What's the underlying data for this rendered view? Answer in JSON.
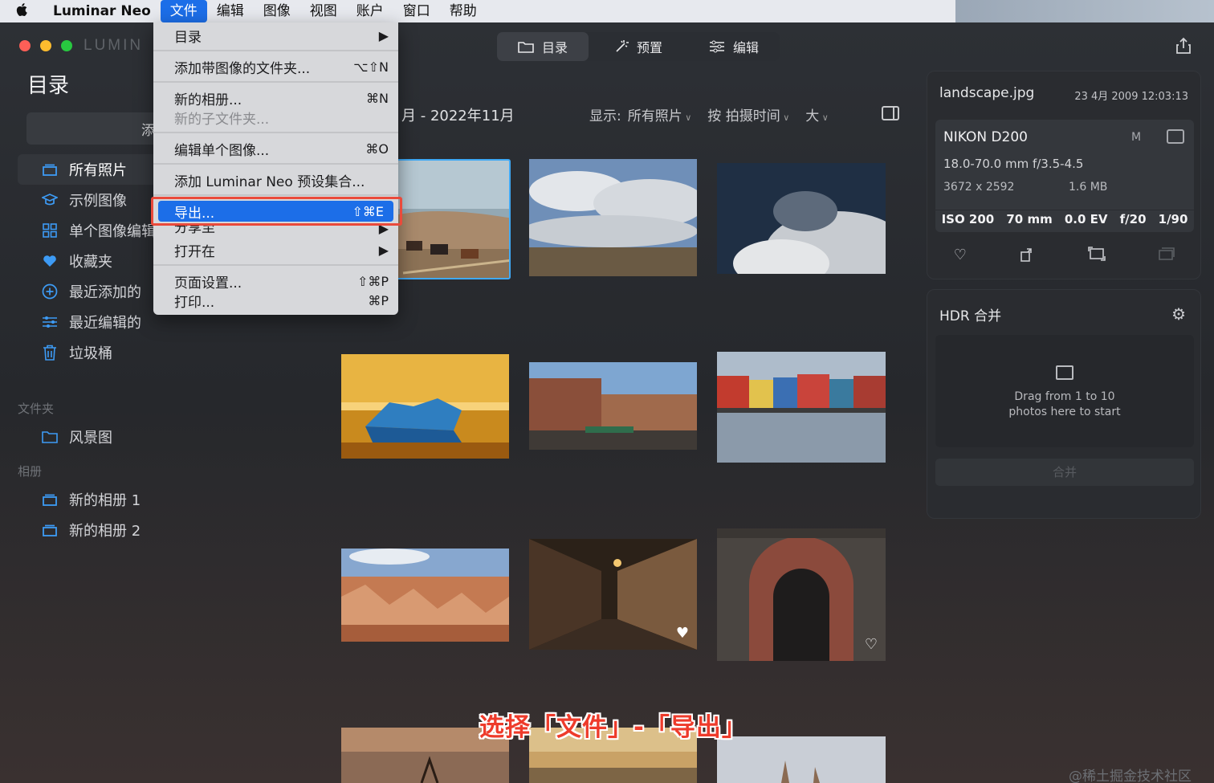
{
  "menubar": {
    "apple": "",
    "items": [
      "Luminar Neo",
      "文件",
      "编辑",
      "图像",
      "视图",
      "账户",
      "窗口",
      "帮助"
    ]
  },
  "window": {
    "brand": "LUMIN",
    "top_tabs": [
      {
        "label": "目录",
        "icon": "catalog-icon"
      },
      {
        "label": "预置",
        "icon": "presets-icon"
      },
      {
        "label": "编辑",
        "icon": "edit-sliders-icon"
      }
    ]
  },
  "sidebar": {
    "title": "目录",
    "add_label": "添",
    "items": [
      {
        "label": "所有照片",
        "icon": "stack-icon"
      },
      {
        "label": "示例图像",
        "icon": "graduation-cap-icon"
      },
      {
        "label": "单个图像编辑",
        "icon": "grid-icon"
      },
      {
        "label": "收藏夹",
        "icon": "heart-icon"
      },
      {
        "label": "最近添加的",
        "icon": "plus-circle-icon"
      },
      {
        "label": "最近编辑的",
        "icon": "sliders-icon"
      },
      {
        "label": "垃圾桶",
        "icon": "trash-icon"
      }
    ],
    "folders_label": "文件夹",
    "folders": [
      {
        "label": "风景图",
        "icon": "folder-icon"
      }
    ],
    "albums_label": "相册",
    "albums": [
      {
        "label": "新的相册 1",
        "icon": "album-icon"
      },
      {
        "label": "新的相册 2",
        "icon": "album-icon"
      }
    ]
  },
  "main": {
    "date_heading": "月 - 2022年11月",
    "filter_show_label": "显示:",
    "filter_show_value": "所有照片",
    "filter_sort": "按 拍摄时间",
    "filter_size": "大"
  },
  "file_menu": {
    "items": [
      {
        "label": "目录",
        "shortcut": "▶"
      },
      {
        "label": "添加带图像的文件夹...",
        "shortcut": "⌥⇧N"
      },
      {
        "label": "新的相册...",
        "shortcut": "⌘N"
      },
      {
        "label": "新的子文件夹...",
        "shortcut": ""
      },
      {
        "label": "编辑单个图像...",
        "shortcut": "⌘O"
      },
      {
        "label": "添加 Luminar Neo 预设集合...",
        "shortcut": ""
      },
      {
        "label": "导出...",
        "shortcut": "⇧⌘E"
      },
      {
        "label": "分享至",
        "shortcut": "▶"
      },
      {
        "label": "打开在",
        "shortcut": "▶"
      },
      {
        "label": "页面设置...",
        "shortcut": "⇧⌘P"
      },
      {
        "label": "打印...",
        "shortcut": "⌘P"
      }
    ]
  },
  "info_panel": {
    "filename": "landscape.jpg",
    "date": "23 4月 2009 12:03:13",
    "camera": "NIKON D200",
    "mode": "M",
    "lens": "18.0-70.0 mm f/3.5-4.5",
    "dimensions": "3672 x 2592",
    "file_size": "1.6 MB",
    "exif": [
      "ISO 200",
      "70 mm",
      "0.0 EV",
      "f/20",
      "1/90"
    ]
  },
  "hdr_panel": {
    "title": "HDR 合并",
    "drop_text_1": "Drag from 1 to 10",
    "drop_text_2": "photos here to start",
    "merge_label": "合并"
  },
  "caption": "选择「文件」-「导出」",
  "watermark": "@稀土掘金技术社区",
  "colors": {
    "accent": "#1c6ee8",
    "highlight_frame": "#ea4a3b",
    "sidebar_icon": "#3d9bf5"
  }
}
